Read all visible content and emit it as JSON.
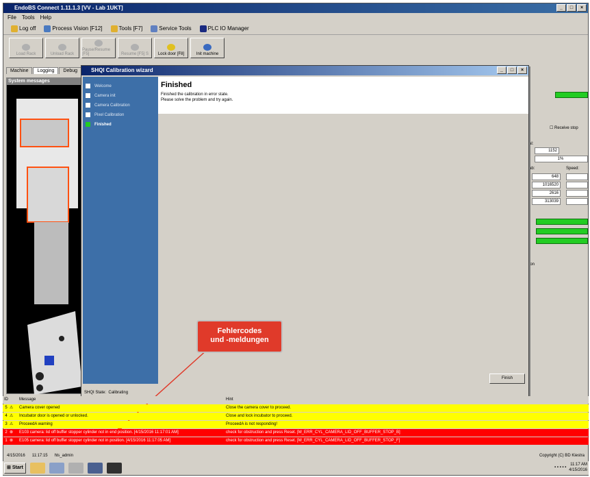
{
  "app": {
    "title": "EndoBS Connect 1.11.1.3 [VV - Lab 1UKT]"
  },
  "menu": [
    "File",
    "Tools",
    "Help"
  ],
  "toolbar": {
    "log_off": "Log off",
    "process_vision": "Process Vision [F12]",
    "tools": "Tools [F7]",
    "service_tools": "Service Tools",
    "plc_io": "PLC IO Manager"
  },
  "bigbuttons": [
    "Load Rack",
    "Unload Rack",
    "Pause/Resume [F5]",
    "Resume [F5] S",
    "Lock door [F8]",
    "Init machine"
  ],
  "tabs": [
    "Machine",
    "Logging",
    "Debug"
  ],
  "left_panel": {
    "header": "System messages"
  },
  "right_panel": {
    "receive_stop": "Receive stop",
    "label1": "al:",
    "value1": "1152",
    "pct": "1%",
    "label2": "ab:",
    "speed_label": "Speed:",
    "values": [
      "648",
      "1016520",
      "2616",
      "313039"
    ],
    "label3": "ion"
  },
  "dialog": {
    "title": "SHQI Calibration wizard",
    "steps": [
      "Welcome",
      "Camera init",
      "Camera Calibration",
      "Pixel Calibration",
      "Finished"
    ],
    "heading": "Finished",
    "text_line1": "Finished the calibration in error state.",
    "text_line2": "Please solve the problem and try again.",
    "finish_label": "Finish",
    "status_label": "SHQI State:",
    "status_value": "Calibrating"
  },
  "annotation": {
    "line1": "Fehlercodes",
    "line2": "und -meldungen"
  },
  "messages": {
    "header": {
      "id": "ID",
      "message": "Message",
      "hint": "Hint"
    },
    "rows": [
      {
        "id": "5",
        "icon": "warning-icon",
        "message": "Camera cover opened",
        "hint": "Close the camera cover to proceed.",
        "level": "warning"
      },
      {
        "id": "4",
        "icon": "warning-icon",
        "message": "Incubator door is opened or unlocked.",
        "hint": "Close and lock incubator to proceed.",
        "level": "warning"
      },
      {
        "id": "3",
        "icon": "warning-icon",
        "message": "ProceedA warning",
        "hint": "ProceedA is not responding!",
        "level": "warning"
      },
      {
        "id": "2",
        "icon": "error-icon",
        "message": "E103 camera: lid off buffer stopper cylinder not in end position. [4/15/2016 11:17:01 AM]",
        "hint": "check for obstruction and press Reset. [M_ERR_CYL_CAMERA_LID_OFF_BUFFER_STOP_B]",
        "level": "error"
      },
      {
        "id": "1",
        "icon": "error-icon",
        "message": "E105 camera: lid off buffer stopper cylinder not in position. [4/15/2016 11:17:05 AM]",
        "hint": "check for obstruction and press Reset. [M_ERR_CYL_CAMERA_LID_OFF_BUFFER_STOP_F]",
        "level": "error"
      }
    ]
  },
  "statusbar": {
    "date": "4/15/2016",
    "time": "11:17:15",
    "user": "hls_admin",
    "copyright": "Copyright (C) BD Kiestra"
  },
  "taskbar": {
    "start": "Start",
    "clock_time": "11:17 AM",
    "clock_date": "4/15/2016"
  },
  "colors": {
    "warning_row": "#ffff00",
    "error_row": "#ff0000",
    "wizard_side": "#3d6fa8",
    "progress": "#22cc22"
  }
}
